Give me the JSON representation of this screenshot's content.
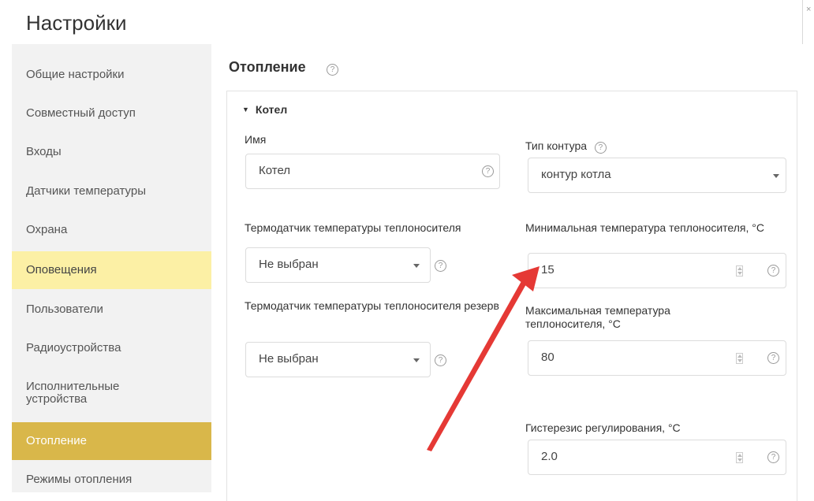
{
  "window": {
    "title": "Настройки",
    "close_glyph": "×"
  },
  "sidebar": {
    "items": [
      {
        "label": "Общие настройки"
      },
      {
        "label": "Совместный доступ"
      },
      {
        "label": "Входы"
      },
      {
        "label": "Датчики температуры"
      },
      {
        "label": "Охрана"
      },
      {
        "label": "Оповещения"
      },
      {
        "label": "Пользователи"
      },
      {
        "label": "Радиоустройства"
      },
      {
        "label": "Исполнительные устройства"
      },
      {
        "label": "Отопление"
      },
      {
        "label": "Режимы отопления"
      }
    ],
    "highlighted": "Оповещения",
    "active": "Отопление"
  },
  "main": {
    "title": "Отопление",
    "help_glyph": "?",
    "section": {
      "title": "Котел",
      "name": {
        "label": "Имя",
        "value": "Котел"
      },
      "circuit_type": {
        "label": "Тип контура",
        "value": "контур котла"
      },
      "sensor": {
        "label": "Термодатчик температуры теплоносителя",
        "value": "Не выбран"
      },
      "sensor_reserve": {
        "label": "Термодатчик температуры теплоносителя резерв",
        "value": "Не выбран"
      },
      "min_temp": {
        "label": "Минимальная температура теплоносителя, °C",
        "value": "15"
      },
      "max_temp": {
        "label": "Максимальная температура теплоносителя, °C",
        "value": "80"
      },
      "hysteresis": {
        "label": "Гистерезис регулирования, °C",
        "value": "2.0"
      }
    }
  },
  "colors": {
    "highlight_light": "#fcf0a5",
    "active_item": "#d9b74a",
    "annotation_arrow": "#e53935"
  },
  "icons": [
    "help-icon",
    "dropdown-caret-icon",
    "spinner-icon",
    "collapse-triangle-icon",
    "close-icon"
  ]
}
